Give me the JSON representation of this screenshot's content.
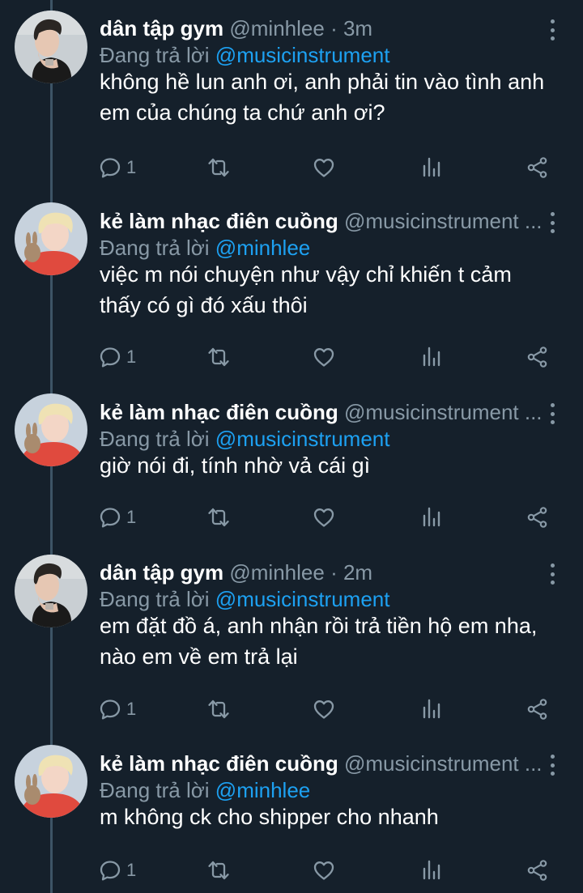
{
  "colors": {
    "background": "#15202b",
    "primary_text": "#ffffff",
    "secondary_text": "#8899a6",
    "link": "#1da1f2",
    "thread_line": "#3d5466"
  },
  "tweets": [
    {
      "display_name": "dân tập gym",
      "handle": "@minhlee",
      "separator": "·",
      "time": "3m",
      "reply_prefix": "Đang trả lời",
      "reply_to": "@musicinstrument",
      "text": "không hề lun anh ơi, anh phải tin vào tình anh em của chúng ta chứ anh ơi?",
      "reply_count": "1",
      "avatar": "avatar-dark-hair"
    },
    {
      "display_name": "kẻ làm nhạc điên cuồng",
      "handle": "@musicinstrument ...",
      "reply_prefix": "Đang trả lời",
      "reply_to": "@minhlee",
      "text": "việc m nói chuyện như vậy chỉ khiến t cảm thấy có gì đó xấu thôi",
      "reply_count": "1",
      "avatar": "avatar-blond-hair"
    },
    {
      "display_name": "kẻ làm nhạc điên cuồng",
      "handle": "@musicinstrument ...",
      "reply_prefix": "Đang trả lời",
      "reply_to": "@musicinstrument",
      "text": "giờ nói đi, tính nhờ vả cái gì",
      "reply_count": "1",
      "avatar": "avatar-blond-hair"
    },
    {
      "display_name": "dân tập gym",
      "handle": "@minhlee",
      "separator": "·",
      "time": "2m",
      "reply_prefix": "Đang trả lời",
      "reply_to": "@musicinstrument",
      "text": "em đặt đồ á, anh nhận rồi trả tiền hộ em nha, nào em về em trả lại",
      "reply_count": "1",
      "avatar": "avatar-dark-hair"
    },
    {
      "display_name": "kẻ làm nhạc điên cuồng",
      "handle": "@musicinstrument ...",
      "reply_prefix": "Đang trả lời",
      "reply_to": "@minhlee",
      "text": "m không ck cho shipper cho nhanh",
      "reply_count": "1",
      "avatar": "avatar-blond-hair"
    }
  ],
  "icons": {
    "reply": "reply-icon",
    "retweet": "retweet-icon",
    "like": "like-icon",
    "analytics": "analytics-icon",
    "share": "share-icon",
    "more": "more-options-icon"
  }
}
